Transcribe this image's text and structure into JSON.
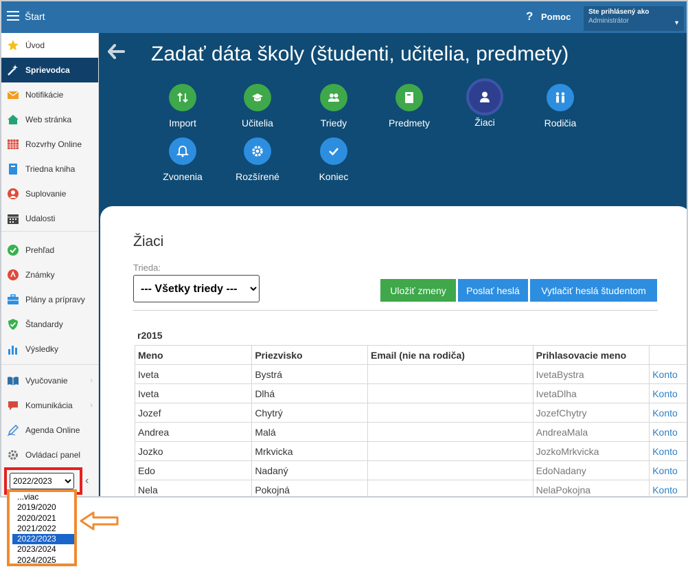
{
  "topbar": {
    "title": "Štart",
    "help_icon": "?",
    "help_label": "Pomoc",
    "user_caption": "Ste prihlásený ako",
    "user_role": "Administrátor",
    "user_caret": "▼"
  },
  "sidebar": {
    "items": [
      {
        "label": "Úvod",
        "icon": "star-icon"
      },
      {
        "label": "Sprievodca",
        "icon": "magic-wand-icon"
      },
      {
        "label": "Notifikácie",
        "icon": "envelope-icon"
      },
      {
        "label": "Web stránka",
        "icon": "house-icon"
      },
      {
        "label": "Rozvrhy Online",
        "icon": "schedule-grid-icon"
      },
      {
        "label": "Triedna kniha",
        "icon": "book-icon"
      },
      {
        "label": "Suplovanie",
        "icon": "person-icon"
      },
      {
        "label": "Udalosti",
        "icon": "calendar-icon"
      },
      {
        "label": "Prehľad",
        "icon": "check-circle-icon"
      },
      {
        "label": "Známky",
        "icon": "grade-icon"
      },
      {
        "label": "Plány a prípravy",
        "icon": "briefcase-icon"
      },
      {
        "label": "Štandardy",
        "icon": "shield-check-icon"
      },
      {
        "label": "Výsledky",
        "icon": "bar-chart-icon"
      },
      {
        "label": "Vyučovanie",
        "icon": "open-book-icon"
      },
      {
        "label": "Komunikácia",
        "icon": "chat-icon"
      },
      {
        "label": "Agenda Online",
        "icon": "pen-icon"
      },
      {
        "label": "Ovládací panel",
        "icon": "gear-icon"
      }
    ],
    "submenu_chevron": "›",
    "collapse_chevron": "‹",
    "year_selected": "2022/2023"
  },
  "header": {
    "back_arrow": "🡐",
    "title": "Zadať dáta školy (študenti, učitelia, predmety)"
  },
  "steps": [
    {
      "label": "Import",
      "color": "#3ea84a"
    },
    {
      "label": "Učitelia",
      "color": "#3ea84a"
    },
    {
      "label": "Triedy",
      "color": "#3ea84a"
    },
    {
      "label": "Predmety",
      "color": "#3ea84a"
    },
    {
      "label": "Žiaci",
      "color": "#2e3f8f"
    },
    {
      "label": "Rodičia",
      "color": "#2d8ee0"
    },
    {
      "label": "Zvonenia",
      "color": "#2d8ee0"
    },
    {
      "label": "Rozšírené",
      "color": "#2d8ee0"
    },
    {
      "label": "Koniec",
      "color": "#2d8ee0"
    }
  ],
  "content": {
    "section_title": "Žiaci",
    "class_label": "Trieda:",
    "class_selected": "--- Všetky triedy ---",
    "buttons": {
      "save": "Uložiť zmeny",
      "send": "Poslať heslá",
      "print": "Vytlačiť heslá študentom"
    },
    "group_name": "r2015",
    "columns": [
      "Meno",
      "Priezvisko",
      "Email (nie na rodiča)",
      "Prihlasovacie meno",
      ""
    ],
    "rows": [
      {
        "first": "Iveta",
        "last": "Bystrá",
        "email": "",
        "login": "IvetaBystra",
        "action": "Konto"
      },
      {
        "first": "Iveta",
        "last": "Dlhá",
        "email": "",
        "login": "IvetaDlha",
        "action": "Konto"
      },
      {
        "first": "Jozef",
        "last": "Chytrý",
        "email": "",
        "login": "JozefChytry",
        "action": "Konto"
      },
      {
        "first": "Andrea",
        "last": "Malá",
        "email": "",
        "login": "AndreaMala",
        "action": "Konto"
      },
      {
        "first": "Jozko",
        "last": "Mrkvicka",
        "email": "",
        "login": "JozkoMrkvicka",
        "action": "Konto"
      },
      {
        "first": "Edo",
        "last": "Nadaný",
        "email": "",
        "login": "EdoNadany",
        "action": "Konto"
      },
      {
        "first": "Nela",
        "last": "Pokojná",
        "email": "",
        "login": "NelaPokojna",
        "action": "Konto"
      }
    ]
  },
  "year_dropdown": {
    "options": [
      "...viac",
      "2019/2020",
      "2020/2021",
      "2021/2022",
      "2022/2023",
      "2023/2024",
      "2024/2025"
    ],
    "selected": "2022/2023"
  },
  "colors": {
    "topbar": "#2a6fa8",
    "header_bg": "#0f4b74",
    "sidebar_active": "#10406a",
    "highlight_red": "#e52020",
    "highlight_orange": "#f08a30",
    "link": "#2d7fc4"
  }
}
